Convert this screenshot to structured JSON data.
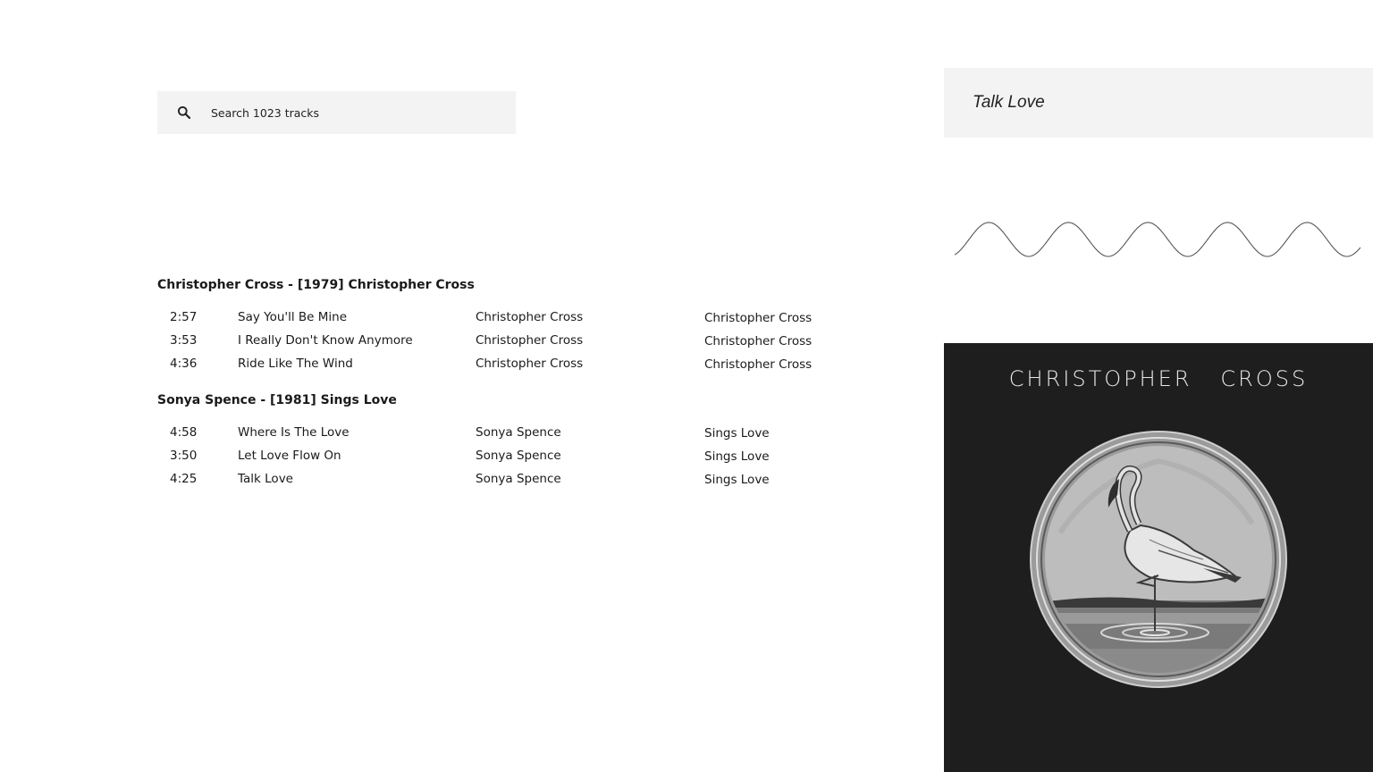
{
  "search": {
    "placeholder": "Search 1023 tracks",
    "icon": "search-icon"
  },
  "groups": [
    {
      "title": "Christopher Cross - [1979] Christopher Cross",
      "tracks": [
        {
          "duration": "2:57",
          "title": "Say You'll Be Mine",
          "artist": "Christopher Cross",
          "album": "Christopher Cross"
        },
        {
          "duration": "3:53",
          "title": "I Really Don't Know Anymore",
          "artist": "Christopher Cross",
          "album": "Christopher Cross"
        },
        {
          "duration": "4:36",
          "title": "Ride Like The Wind",
          "artist": "Christopher Cross",
          "album": "Christopher Cross"
        }
      ]
    },
    {
      "title": "Sonya Spence - [1981] Sings Love",
      "tracks": [
        {
          "duration": "4:58",
          "title": "Where Is The Love",
          "artist": "Sonya Spence",
          "album": "Sings Love"
        },
        {
          "duration": "3:50",
          "title": "Let Love Flow On",
          "artist": "Sonya Spence",
          "album": "Sings Love"
        },
        {
          "duration": "4:25",
          "title": "Talk Love",
          "artist": "Sonya Spence",
          "album": "Sings Love"
        }
      ]
    }
  ],
  "now_playing": {
    "title": "Talk Love"
  },
  "cover": {
    "text": "CHRISTOPHER   CROSS",
    "background": "#1e1e1e"
  }
}
